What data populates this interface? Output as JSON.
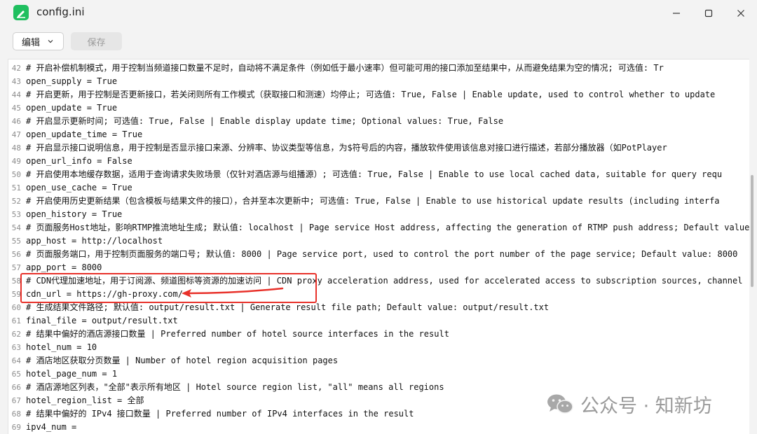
{
  "window": {
    "title": "config.ini",
    "minimize_glyph": "—",
    "maximize_glyph": "☐",
    "close_glyph": "✕"
  },
  "toolbar": {
    "edit_label": "编辑",
    "save_label": "保存"
  },
  "editor": {
    "lines": [
      {
        "n": "42",
        "text": "# 开启补偿机制模式，用于控制当频道接口数量不足时，自动将不满足条件（例如低于最小速率）但可能可用的接口添加至结果中，从而避免结果为空的情况; 可选值: Tr"
      },
      {
        "n": "43",
        "text": "open_supply = True"
      },
      {
        "n": "44",
        "text": "# 开启更新，用于控制是否更新接口，若关闭则所有工作模式（获取接口和测速）均停止; 可选值: True, False | Enable update, used to control whether to update"
      },
      {
        "n": "45",
        "text": "open_update = True"
      },
      {
        "n": "46",
        "text": "# 开启显示更新时间; 可选值: True, False | Enable display update time; Optional values: True, False"
      },
      {
        "n": "47",
        "text": "open_update_time = True"
      },
      {
        "n": "48",
        "text": "# 开启显示接口说明信息，用于控制是否显示接口来源、分辨率、协议类型等信息，为$符号后的内容，播放软件使用该信息对接口进行描述，若部分播放器（如PotPlayer"
      },
      {
        "n": "49",
        "text": "open_url_info = False"
      },
      {
        "n": "50",
        "text": "# 开启使用本地缓存数据，适用于查询请求失败场景（仅针对酒店源与组播源）; 可选值: True, False | Enable to use local cached data, suitable for query requ"
      },
      {
        "n": "51",
        "text": "open_use_cache = True"
      },
      {
        "n": "52",
        "text": "# 开启使用历史更新结果（包含模板与结果文件的接口），合并至本次更新中; 可选值: True, False | Enable to use historical update results (including interfa"
      },
      {
        "n": "53",
        "text": "open_history = True"
      },
      {
        "n": "54",
        "text": "# 页面服务Host地址，影响RTMP推流地址生成; 默认值: localhost | Page service Host address, affecting the generation of RTMP push address; Default value:"
      },
      {
        "n": "55",
        "text": "app_host = http://localhost"
      },
      {
        "n": "56",
        "text": "# 页面服务端口，用于控制页面服务的端口号; 默认值: 8000 | Page service port, used to control the port number of the page service; Default value: 8000"
      },
      {
        "n": "57",
        "text": "app_port = 8000"
      },
      {
        "n": "58",
        "text": "# CDN代理加速地址，用于订阅源、频道图标等资源的加速访问 | CDN proxy acceleration address, used for accelerated access to subscription sources, channel"
      },
      {
        "n": "59",
        "text": "cdn_url = https://gh-proxy.com/"
      },
      {
        "n": "60",
        "text": "# 生成结果文件路径; 默认值: output/result.txt | Generate result file path; Default value: output/result.txt"
      },
      {
        "n": "61",
        "text": "final_file = output/result.txt"
      },
      {
        "n": "62",
        "text": "# 结果中偏好的酒店源接口数量 | Preferred number of hotel source interfaces in the result"
      },
      {
        "n": "63",
        "text": "hotel_num = 10"
      },
      {
        "n": "64",
        "text": "# 酒店地区获取分页数量 | Number of hotel region acquisition pages"
      },
      {
        "n": "65",
        "text": "hotel_page_num = 1"
      },
      {
        "n": "66",
        "text": "# 酒店源地区列表，\"全部\"表示所有地区 | Hotel source region list, \"all\" means all regions"
      },
      {
        "n": "67",
        "text": "hotel_region_list = 全部"
      },
      {
        "n": "68",
        "text": "# 结果中偏好的 IPv4 接口数量 | Preferred number of IPv4 interfaces in the result"
      },
      {
        "n": "69",
        "text": "ipv4_num ="
      }
    ]
  },
  "watermark": {
    "text": "公众号 · 知新坊"
  },
  "colors": {
    "highlight": "#e8312a",
    "app_icon": "#1fbf5f"
  }
}
